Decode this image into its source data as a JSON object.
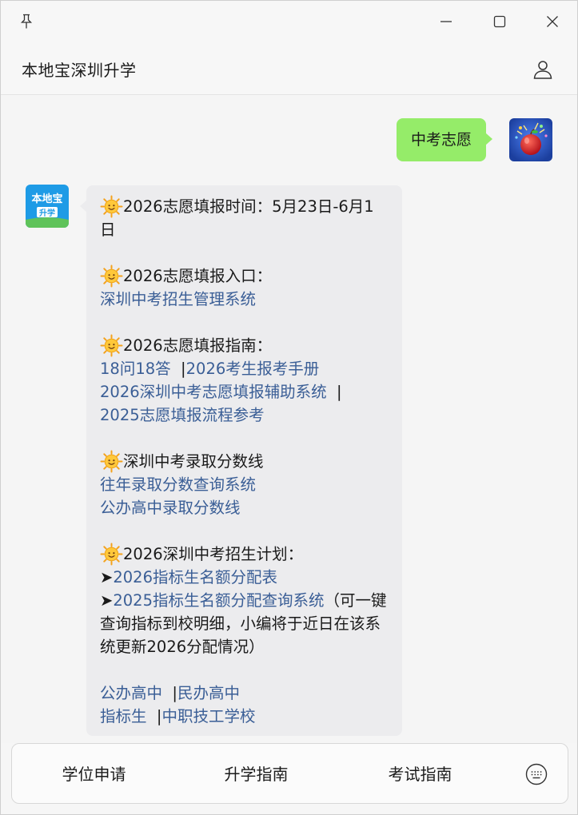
{
  "window": {
    "controls": {
      "pin": "pin-icon",
      "minimize": "minimize-icon",
      "maximize": "maximize-icon",
      "close": "close-icon"
    }
  },
  "header": {
    "title": "本地宝深圳升学",
    "profile_icon": "person-icon"
  },
  "colors": {
    "user_bubble": "#95ec69",
    "bot_bubble": "#ececee",
    "link": "#3a5e96"
  },
  "chat": {
    "user_message": "中考志愿",
    "bot_avatar_text": {
      "top": "本地宝",
      "bottom": "升学"
    },
    "bot_message": {
      "sections": [
        {
          "emoji": "sun-face-icon",
          "heading": "2026志愿填报时间：5月23日-6月1日"
        },
        {
          "emoji": "sun-face-icon",
          "heading": "2026志愿填报入口：",
          "link": "深圳中考招生管理系统"
        },
        {
          "emoji": "sun-face-icon",
          "heading": "2026志愿填报指南：",
          "links": [
            "18问18答",
            "2026考生报考手册",
            "2026深圳中考志愿填报辅助系统",
            "2025志愿填报流程参考"
          ],
          "separator": "|"
        },
        {
          "emoji": "sun-face-icon",
          "heading": "深圳中考录取分数线",
          "links": [
            "往年录取分数查询系统",
            "公办高中录取分数线"
          ]
        },
        {
          "emoji": "sun-face-icon",
          "heading": "2026深圳中考招生计划：",
          "arrow": "➤",
          "links": [
            "2026指标生名额分配表",
            "2025指标生名额分配查询系统"
          ],
          "note": "（可一键查询指标到校明细，小编将于近日在该系统更新2026分配情况）"
        },
        {
          "links": [
            "公办高中",
            "民办高中",
            "指标生",
            "中职技工学校"
          ]
        }
      ]
    }
  },
  "bottom_menu": {
    "items": [
      "学位申请",
      "升学指南",
      "考试指南"
    ],
    "keyboard_icon": "keyboard-icon"
  }
}
